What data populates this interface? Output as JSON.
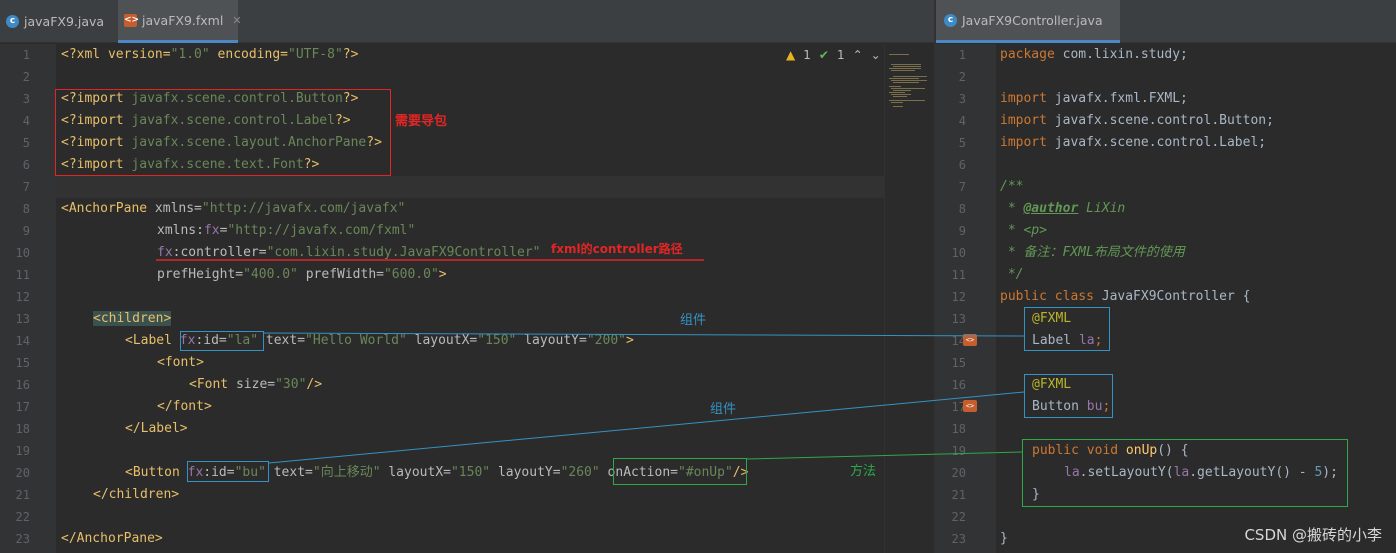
{
  "tabs_left": [
    {
      "label": "javaFX9.java",
      "icon": "java-class-icon",
      "active": false
    },
    {
      "label": "javaFX9.fxml",
      "icon": "fxml-file-icon",
      "active": true
    }
  ],
  "tabs_right": [
    {
      "label": "JavaFX9Controller.java",
      "icon": "java-class-icon",
      "active": true
    }
  ],
  "inspection": {
    "warnings": "1",
    "ok": "1"
  },
  "fxml_lines": [
    "1",
    "2",
    "3",
    "4",
    "5",
    "6",
    "7",
    "8",
    "9",
    "10",
    "11",
    "12",
    "13",
    "14",
    "15",
    "16",
    "17",
    "18",
    "19",
    "20",
    "21",
    "22",
    "23"
  ],
  "fxml_code": {
    "l1_a": "<?xml version=",
    "l1_b": "\"1.0\"",
    "l1_c": " encoding=",
    "l1_d": "\"UTF-8\"",
    "l1_e": "?>",
    "l3_a": "<?import ",
    "l3_b": "javafx.scene.control.Button",
    "l3_c": "?>",
    "l4_b": "javafx.scene.control.Label",
    "l5_b": "javafx.scene.layout.AnchorPane",
    "l6_b": "javafx.scene.text.Font",
    "l8_a": "<AnchorPane",
    "l8_b": " xmlns=",
    "l8_c": "\"http://javafx.com/javafx\"",
    "l9_a": "xmlns:",
    "l9_b": "fx",
    "l9_c": "=",
    "l9_d": "\"http://javafx.com/fxml\"",
    "l10_a": "fx",
    "l10_b": ":controller=",
    "l10_c": "\"com.lixin.study.JavaFX9Controller\"",
    "l11_a": "prefHeight=",
    "l11_b": "\"400.0\"",
    "l11_c": " prefWidth=",
    "l11_d": "\"600.0\"",
    "l11_e": ">",
    "l13": "<children>",
    "l14_a": "<Label ",
    "l14_b": "fx",
    "l14_c": ":id=",
    "l14_d": "\"la\"",
    "l14_e": " text=",
    "l14_f": "\"Hello World\"",
    "l14_g": " layoutX=",
    "l14_h": "\"150\"",
    "l14_i": " layoutY=",
    "l14_j": "\"200\"",
    "l14_k": ">",
    "l15": "<font>",
    "l16_a": "<Font",
    "l16_b": " size=",
    "l16_c": "\"30\"",
    "l16_d": "/>",
    "l17": "</font>",
    "l18": "</Label>",
    "l20_a": "<Button ",
    "l20_b": "fx",
    "l20_c": ":id=",
    "l20_d": "\"bu\"",
    "l20_e": " text=",
    "l20_f": "\"向上移动\"",
    "l20_g": " layoutX=",
    "l20_h": "\"150\"",
    "l20_i": " layoutY=",
    "l20_j": "\"260\"",
    "l20_k": " onAction=",
    "l20_l": "\"#onUp\"",
    "l20_m": "/>",
    "l21": "</children>",
    "l23": "</AnchorPane>"
  },
  "java_code": {
    "l1_a": "package ",
    "l1_b": "com.lixin.study;",
    "l3_a": "import ",
    "l3_b": "javafx.fxml.FXML;",
    "l4_b": "javafx.scene.control.Button;",
    "l5_b": "javafx.scene.control.Label;",
    "l7": "/**",
    "l8_a": " * ",
    "l8_b": "@author",
    "l8_c": " LiXin",
    "l9": " * <p>",
    "l10": " * 备注：FXML布局文件的使用",
    "l11": " */",
    "l12_a": "public class ",
    "l12_b": "JavaFX9Controller {",
    "l13": "@FXML",
    "l14_a": "Label ",
    "l14_b": "la",
    "l14_c": ";",
    "l16": "@FXML",
    "l17_a": "Button ",
    "l17_b": "bu",
    "l17_c": ";",
    "l19_a": "public void ",
    "l19_b": "onUp",
    "l19_c": "() {",
    "l20_a": "la",
    "l20_b": ".setLayoutY(",
    "l20_c": "la",
    "l20_d": ".getLayoutY() - ",
    "l20_e": "5",
    "l20_f": ");",
    "l21": "}",
    "l23": "}"
  },
  "annotations": {
    "import_note": "需要导包",
    "controller_note": "fxml的controller路径",
    "component1": "组件",
    "component2": "组件",
    "method": "方法"
  },
  "watermark": "CSDN @搬砖的小李",
  "colors": {
    "red": "#e22525",
    "blue": "#3592c4",
    "green": "#2fa84a"
  }
}
